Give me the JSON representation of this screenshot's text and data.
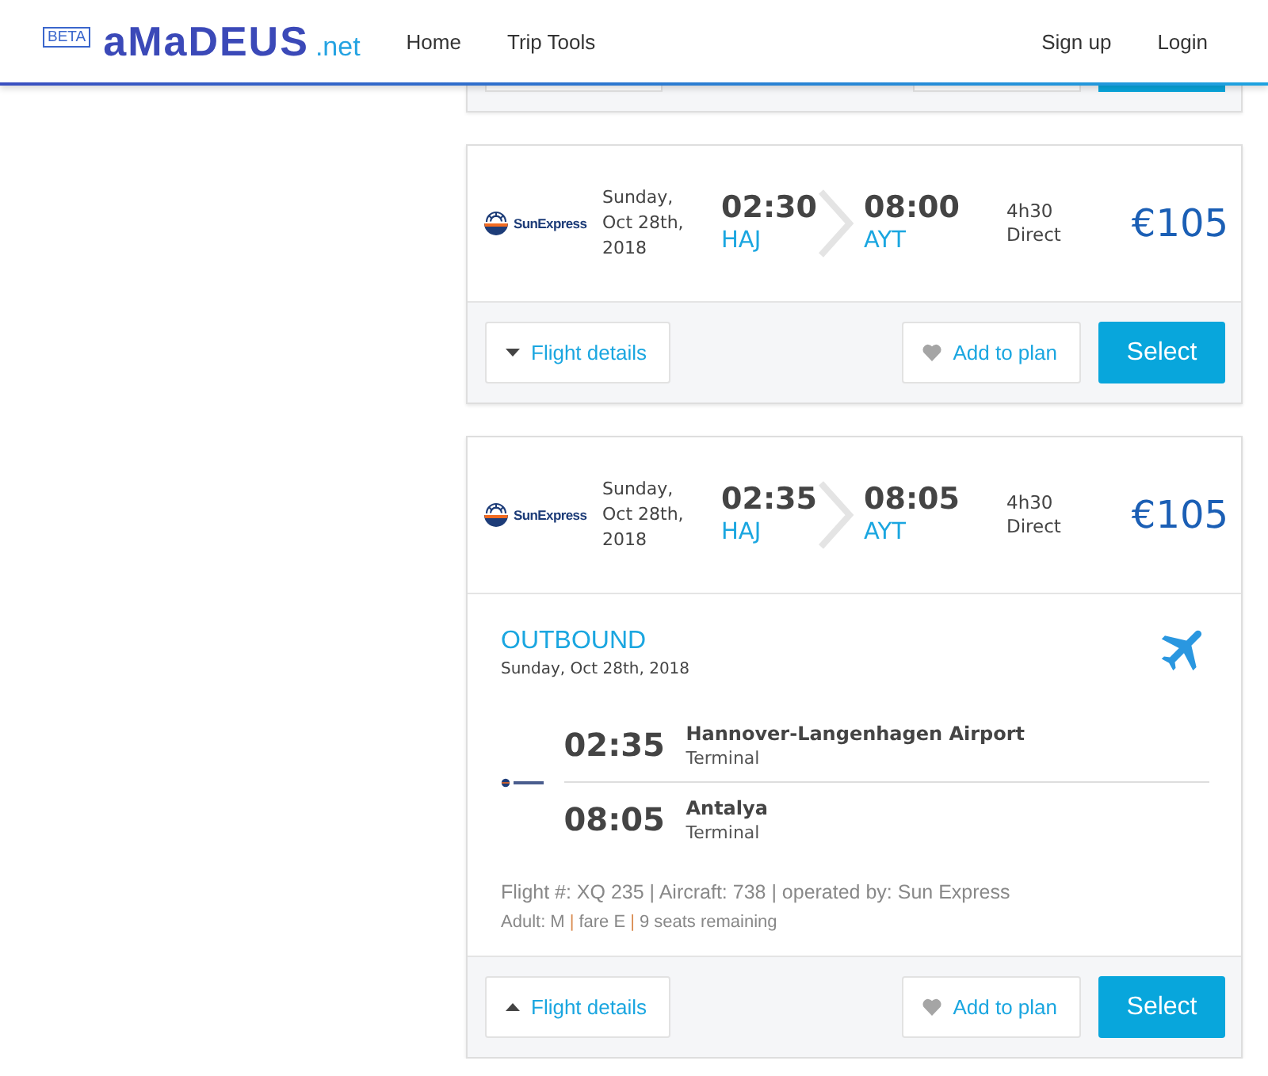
{
  "header": {
    "beta_badge": "BETA",
    "logo": "aMaDEUS",
    "logo_suffix": ".net",
    "nav": [
      "Home",
      "Trip Tools"
    ],
    "account": [
      "Sign up",
      "Login"
    ]
  },
  "flights": [
    {
      "airline": "SunExpress",
      "date_lines": [
        "Sunday,",
        "Oct 28th,",
        "2018"
      ],
      "departure": {
        "time": "02:30",
        "airport": "HAJ"
      },
      "arrival": {
        "time": "08:00",
        "airport": "AYT"
      },
      "duration": "4h30",
      "stops": "Direct",
      "price": "€105",
      "details_expanded": false,
      "buttons": {
        "details": "Flight details",
        "plan": "Add to plan",
        "select": "Select"
      }
    },
    {
      "airline": "SunExpress",
      "date_lines": [
        "Sunday,",
        "Oct 28th,",
        "2018"
      ],
      "departure": {
        "time": "02:35",
        "airport": "HAJ"
      },
      "arrival": {
        "time": "08:05",
        "airport": "AYT"
      },
      "duration": "4h30",
      "stops": "Direct",
      "price": "€105",
      "details_expanded": true,
      "details": {
        "heading": "OUTBOUND",
        "date": "Sunday, Oct 28th, 2018",
        "segments": [
          {
            "time": "02:35",
            "place": "Hannover-Langenhagen Airport",
            "terminal": "Terminal"
          },
          {
            "time": "08:05",
            "place": "Antalya",
            "terminal": "Terminal"
          }
        ],
        "flight_info": "Flight #: XQ 235 | Aircraft: 738 | operated by: Sun Express",
        "fare_info": [
          {
            "kind": "text",
            "text": "Adult: M"
          },
          {
            "kind": "separator",
            "text": "|"
          },
          {
            "kind": "text",
            "text": "fare E"
          },
          {
            "kind": "separator",
            "text": "|"
          },
          {
            "kind": "text",
            "text": "9 seats remaining"
          }
        ]
      },
      "buttons": {
        "details": "Flight details",
        "plan": "Add to plan",
        "select": "Select"
      }
    }
  ]
}
